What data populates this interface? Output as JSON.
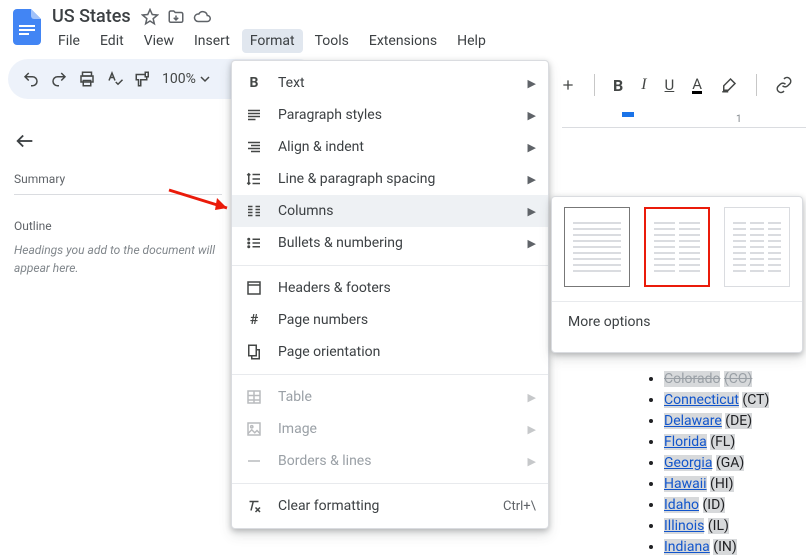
{
  "doc": {
    "title": "US States"
  },
  "menus": {
    "file": "File",
    "edit": "Edit",
    "view": "View",
    "insert": "Insert",
    "format": "Format",
    "tools": "Tools",
    "extensions": "Extensions",
    "help": "Help"
  },
  "toolbar": {
    "zoom": "100%"
  },
  "formatting": {
    "bold": "B",
    "italic": "I",
    "underline": "U",
    "textcolor": "A"
  },
  "outline": {
    "summary": "Summary",
    "heading": "Outline",
    "hint": "Headings you add to the document will appear here."
  },
  "formatMenu": {
    "text": "Text",
    "paragraph": "Paragraph styles",
    "align": "Align & indent",
    "spacing": "Line & paragraph spacing",
    "columns": "Columns",
    "bullets": "Bullets & numbering",
    "headers": "Headers & footers",
    "pagenumbers": "Page numbers",
    "orientation": "Page orientation",
    "table": "Table",
    "image": "Image",
    "borders": "Borders & lines",
    "clear": "Clear formatting",
    "clearShortcut": "Ctrl+\\"
  },
  "columnsSubmenu": {
    "more": "More options"
  },
  "ruler": {
    "mark1": "1"
  },
  "states": [
    {
      "name": "Colorado",
      "abbr": "(CO)"
    },
    {
      "name": "Connecticut",
      "abbr": "(CT)"
    },
    {
      "name": "Delaware",
      "abbr": "(DE)"
    },
    {
      "name": "Florida",
      "abbr": "(FL)"
    },
    {
      "name": "Georgia",
      "abbr": "(GA)"
    },
    {
      "name": "Hawaii",
      "abbr": "(HI)"
    },
    {
      "name": "Idaho",
      "abbr": "(ID)"
    },
    {
      "name": "Illinois",
      "abbr": "(IL)"
    },
    {
      "name": "Indiana",
      "abbr": "(IN)"
    }
  ]
}
